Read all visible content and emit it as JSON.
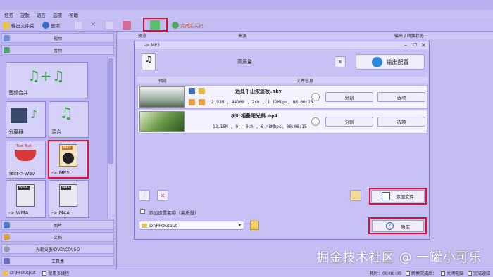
{
  "menu": [
    "任务",
    "皮肤",
    "语言",
    "选项",
    "帮助"
  ],
  "toolbar": {
    "output_folder": "输出文件夹",
    "options": "选项",
    "start_label": "",
    "shutdown_label": "完成后关机"
  },
  "sidebar": {
    "sections": {
      "video": "视频",
      "audio": "音频",
      "image": "图片",
      "document": "文档",
      "rom": "光驱设备\\DVD\\CD\\ISO",
      "tools": "工具集"
    },
    "tiles": [
      {
        "label": "音频合并"
      },
      {
        "label": "分离器"
      },
      {
        "label": "混合"
      },
      {
        "label": "Text->Wav"
      },
      {
        "label": "-> MP3"
      },
      {
        "label": "-> WMA"
      },
      {
        "label": "-> M4A"
      }
    ],
    "tile_badges": {
      "wma": "WMA",
      "m4a": "M4A",
      "mp3": "MP3",
      "tts": "Text Text"
    }
  },
  "main_header": {
    "preview": "预览",
    "source": "来源",
    "status": "输出 / 转换状态"
  },
  "dialog": {
    "title": "-> MP3",
    "quality": "高质量",
    "output_config": "输出配置",
    "col_preview": "预览",
    "col_fileinfo": "文件信息",
    "files": [
      {
        "name": "远处千山浓淡妆.mkv",
        "info": "2.93M , 44100 , 2ch , 1.12Mbps, 00:00:20",
        "split": "分割",
        "options": "选项"
      },
      {
        "name": "树叶相叠阳光斜.mp4",
        "info": "12.15M , 0 , 0ch , 6.48Mbps, 00:00:15",
        "split": "分割",
        "options": "选项"
      }
    ],
    "add_file": "添加文件",
    "add_setting_name": "添加设置名称（高质量）",
    "output_path": "D:\\FFOutput",
    "confirm": "确定"
  },
  "statusbar": {
    "path": "D:\\FFOutput",
    "multithread": "使用多线程",
    "elapsed": "耗时：00:00:00",
    "after_convert": "转换完成后：",
    "shutdown": "关闭电脑",
    "notify": "完成通知"
  },
  "watermark": "掘金技术社区 @ 一罐小可乐",
  "colors": {
    "accent_red": "#e0102a",
    "theme": "#b9b2ee"
  }
}
